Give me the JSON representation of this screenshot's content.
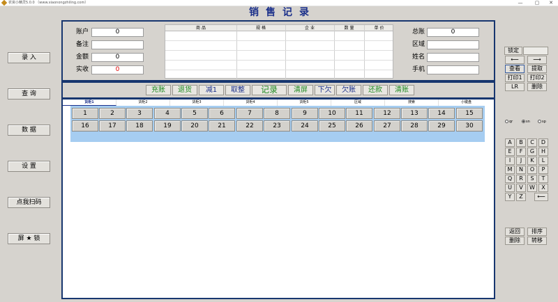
{
  "window": {
    "title": "农资小精灵5.0.0 （www.xiaonongzhiling.com）",
    "minimize": "—",
    "maximize": "▢",
    "close": "✕"
  },
  "heading": "销售记录",
  "left_nav": [
    "录 入",
    "查 询",
    "数 据",
    "设 置",
    "点我扫码",
    "屏 ★ 锁"
  ],
  "form": {
    "account_label": "账户",
    "account_value": "0",
    "note_label": "备注",
    "note_value": "",
    "amount_label": "金额",
    "amount_value": "0",
    "paid_label": "实收",
    "paid_value": "0",
    "total_label": "总账",
    "total_value": "0",
    "region_label": "区域",
    "region_value": "",
    "name_label": "姓名",
    "name_value": "",
    "phone_label": "手机",
    "phone_value": ""
  },
  "grid_columns": [
    "商 品",
    "规 格",
    "企 业",
    "数 量",
    "单 价"
  ],
  "actions": [
    "充账",
    "退货",
    "减1",
    "取整",
    "记录",
    "清屏",
    "下欠",
    "欠账",
    "还款",
    "清账"
  ],
  "tabs": [
    "货柜1",
    "货柜2",
    "货柜3",
    "货柜4",
    "货柜5",
    "区域",
    "搜索",
    "小键盘"
  ],
  "seats": [
    "1",
    "2",
    "3",
    "4",
    "5",
    "6",
    "7",
    "8",
    "9",
    "10",
    "11",
    "12",
    "13",
    "14",
    "15",
    "16",
    "17",
    "18",
    "19",
    "20",
    "21",
    "22",
    "23",
    "24",
    "25",
    "26",
    "27",
    "28",
    "29",
    "30"
  ],
  "right_panel": {
    "lock": "锁定",
    "lock_value": "",
    "left_arrow": "⟵",
    "right_arrow": "⟶",
    "view": "查看",
    "extract": "提取",
    "print1": "打印1",
    "print2": "打印2",
    "lr": "LR",
    "delete": "删除"
  },
  "radios": [
    "qr",
    "sn",
    "sp"
  ],
  "keys": [
    "A",
    "B",
    "C",
    "D",
    "E",
    "F",
    "G",
    "H",
    "I",
    "J",
    "K",
    "L",
    "M",
    "N",
    "O",
    "P",
    "Q",
    "R",
    "S",
    "T",
    "U",
    "V",
    "W",
    "X",
    "Y",
    "Z",
    "⟵"
  ],
  "bottom_buttons": {
    "back": "返回",
    "sort": "排序",
    "delete": "删除",
    "transfer": "转移"
  }
}
